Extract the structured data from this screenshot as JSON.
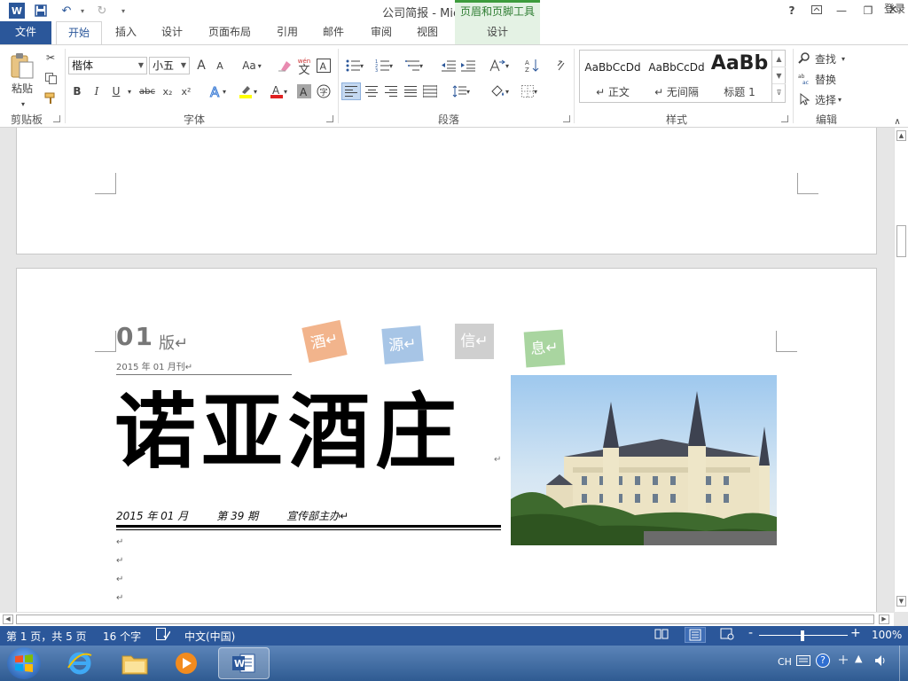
{
  "window": {
    "title": "公司简报 - Microsoft Word",
    "context_tool_title": "页眉和页脚工具",
    "help": "?",
    "login": "登录"
  },
  "tabs": [
    {
      "label": "文件"
    },
    {
      "label": "开始"
    },
    {
      "label": "插入"
    },
    {
      "label": "设计"
    },
    {
      "label": "页面布局"
    },
    {
      "label": "引用"
    },
    {
      "label": "邮件"
    },
    {
      "label": "审阅"
    },
    {
      "label": "视图"
    },
    {
      "label": "设计"
    }
  ],
  "ribbon": {
    "clipboard": {
      "label": "剪贴板",
      "paste": "粘贴"
    },
    "font": {
      "label": "字体",
      "font_name": "楷体",
      "font_size": "小五",
      "bold": "B",
      "italic": "I",
      "underline": "U",
      "strike": "abc",
      "sub": "x₂",
      "sup": "x²",
      "grow": "A",
      "shrink": "A",
      "case": "Aa",
      "phonetic": "wén",
      "wen_char": "文"
    },
    "paragraph": {
      "label": "段落"
    },
    "styles": {
      "label": "样式",
      "items": [
        {
          "sample": "AaBbCcDd",
          "name": "↵ 正文"
        },
        {
          "sample": "AaBbCcDd",
          "name": "↵ 无间隔"
        },
        {
          "sample": "AaBb",
          "name": "标题 1"
        }
      ]
    },
    "editing": {
      "label": "编辑",
      "find": "查找",
      "replace": "替换",
      "select": "选择"
    }
  },
  "document": {
    "edition_num": "01",
    "edition_unit": "版↵",
    "date_small": "2015 年 01 月刊↵",
    "tags": [
      "酒↵",
      "源↵",
      "信↵",
      "息↵"
    ],
    "headline": "诺亚酒庄",
    "headline_mark": "↵",
    "date_line": "2015 年 01 月",
    "issue": "第 39 期",
    "publisher": "宣传部主办↵",
    "para_marks": [
      "↵",
      "↵",
      "↵",
      "↵"
    ]
  },
  "status": {
    "page": "第 1 页，共 5 页",
    "words": "16 个字",
    "lang": "中文(中国)",
    "zoom": "100%",
    "zoom_minus": "-",
    "zoom_plus": "+"
  },
  "taskbar": {
    "ime": "CH"
  },
  "colors": {
    "word_blue": "#2b579a",
    "context_green": "#3d9c3d",
    "tag_orange": "#f2b48c",
    "tag_blue": "#a7c5e6",
    "tag_gray": "#cfcfcf",
    "tag_green": "#a9d5a0"
  }
}
